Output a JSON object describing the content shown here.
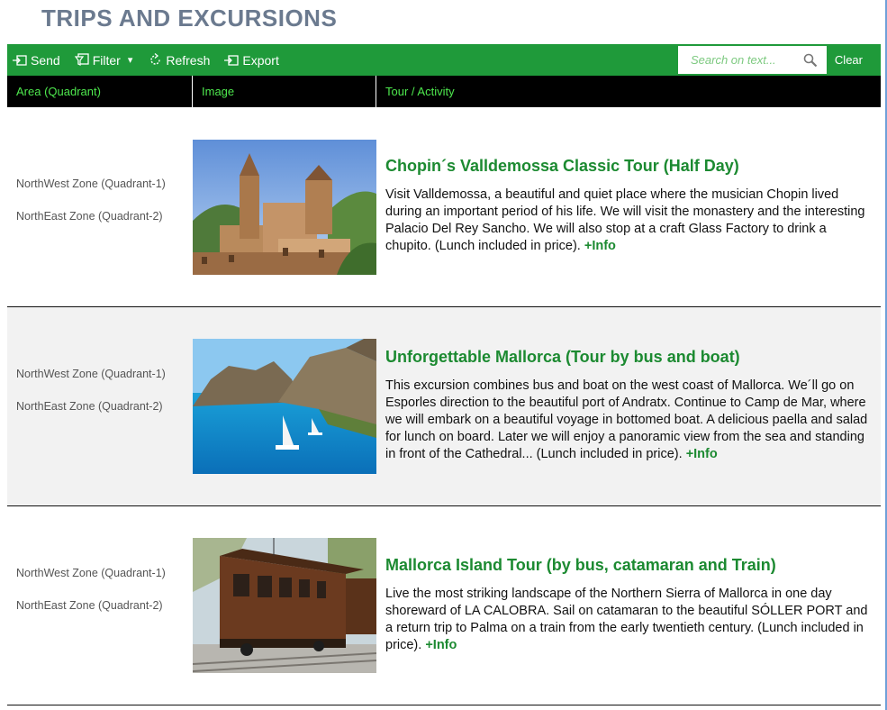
{
  "page": {
    "title": "TRIPS AND EXCURSIONS"
  },
  "toolbar": {
    "send_label": "Send",
    "filter_label": "Filter",
    "filter_dropdown_glyph": "▾",
    "refresh_label": "Refresh",
    "export_label": "Export",
    "search_placeholder": "Search on text...",
    "search_value": "",
    "clear_label": "Clear"
  },
  "table": {
    "headers": {
      "area": "Area (Quadrant)",
      "image": "Image",
      "tour": "Tour / Activity"
    },
    "rows": [
      {
        "areas": [
          "NorthWest Zone (Quadrant-1)",
          "NorthEast Zone (Quadrant-2)"
        ],
        "image": "valldemossa-village-photo",
        "title": "Chopin´s Valldemossa Classic Tour (Half Day)",
        "description": "Visit Valldemossa, a beautiful and quiet place where the musician Chopin lived during an important period of his life. We will visit the monastery and the interesting Palacio Del Rey Sancho. We will also stop at a craft Glass Factory to drink a chupito. (Lunch included in price).",
        "info_label": "+Info"
      },
      {
        "areas": [
          "NorthWest Zone (Quadrant-1)",
          "NorthEast Zone (Quadrant-2)"
        ],
        "image": "coastal-bay-sailboat-photo",
        "title": "Unforgettable Mallorca (Tour by bus and boat)",
        "description": "This excursion combines bus and boat on the west coast of Mallorca. We´ll go on Esporles direction to the beautiful port of Andratx. Continue to Camp de Mar, where we will embark on a beautiful voyage in bottomed boat. A delicious paella and salad for lunch on board. Later we will enjoy a panoramic view from the sea and standing in front of the Cathedral...  (Lunch included in price).",
        "info_label": "+Info"
      },
      {
        "areas": [
          "NorthWest Zone (Quadrant-1)",
          "NorthEast Zone (Quadrant-2)"
        ],
        "image": "vintage-wooden-train-photo",
        "title": "Mallorca Island Tour (by bus, catamaran and Train)",
        "description": "Live the most striking landscape of the Northern Sierra of Mallorca in one day shoreward of LA CALOBRA. Sail on catamaran to the beautiful SÓLLER PORT and a return trip to Palma on a train from the early twentieth century.  (Lunch included in price).",
        "info_label": "+Info"
      }
    ]
  },
  "colors": {
    "toolbar_bg": "#1f9a3a",
    "header_bg": "#000000",
    "header_text": "#4ee84e",
    "title_green": "#1c8a31",
    "page_title": "#6b7a8f"
  }
}
